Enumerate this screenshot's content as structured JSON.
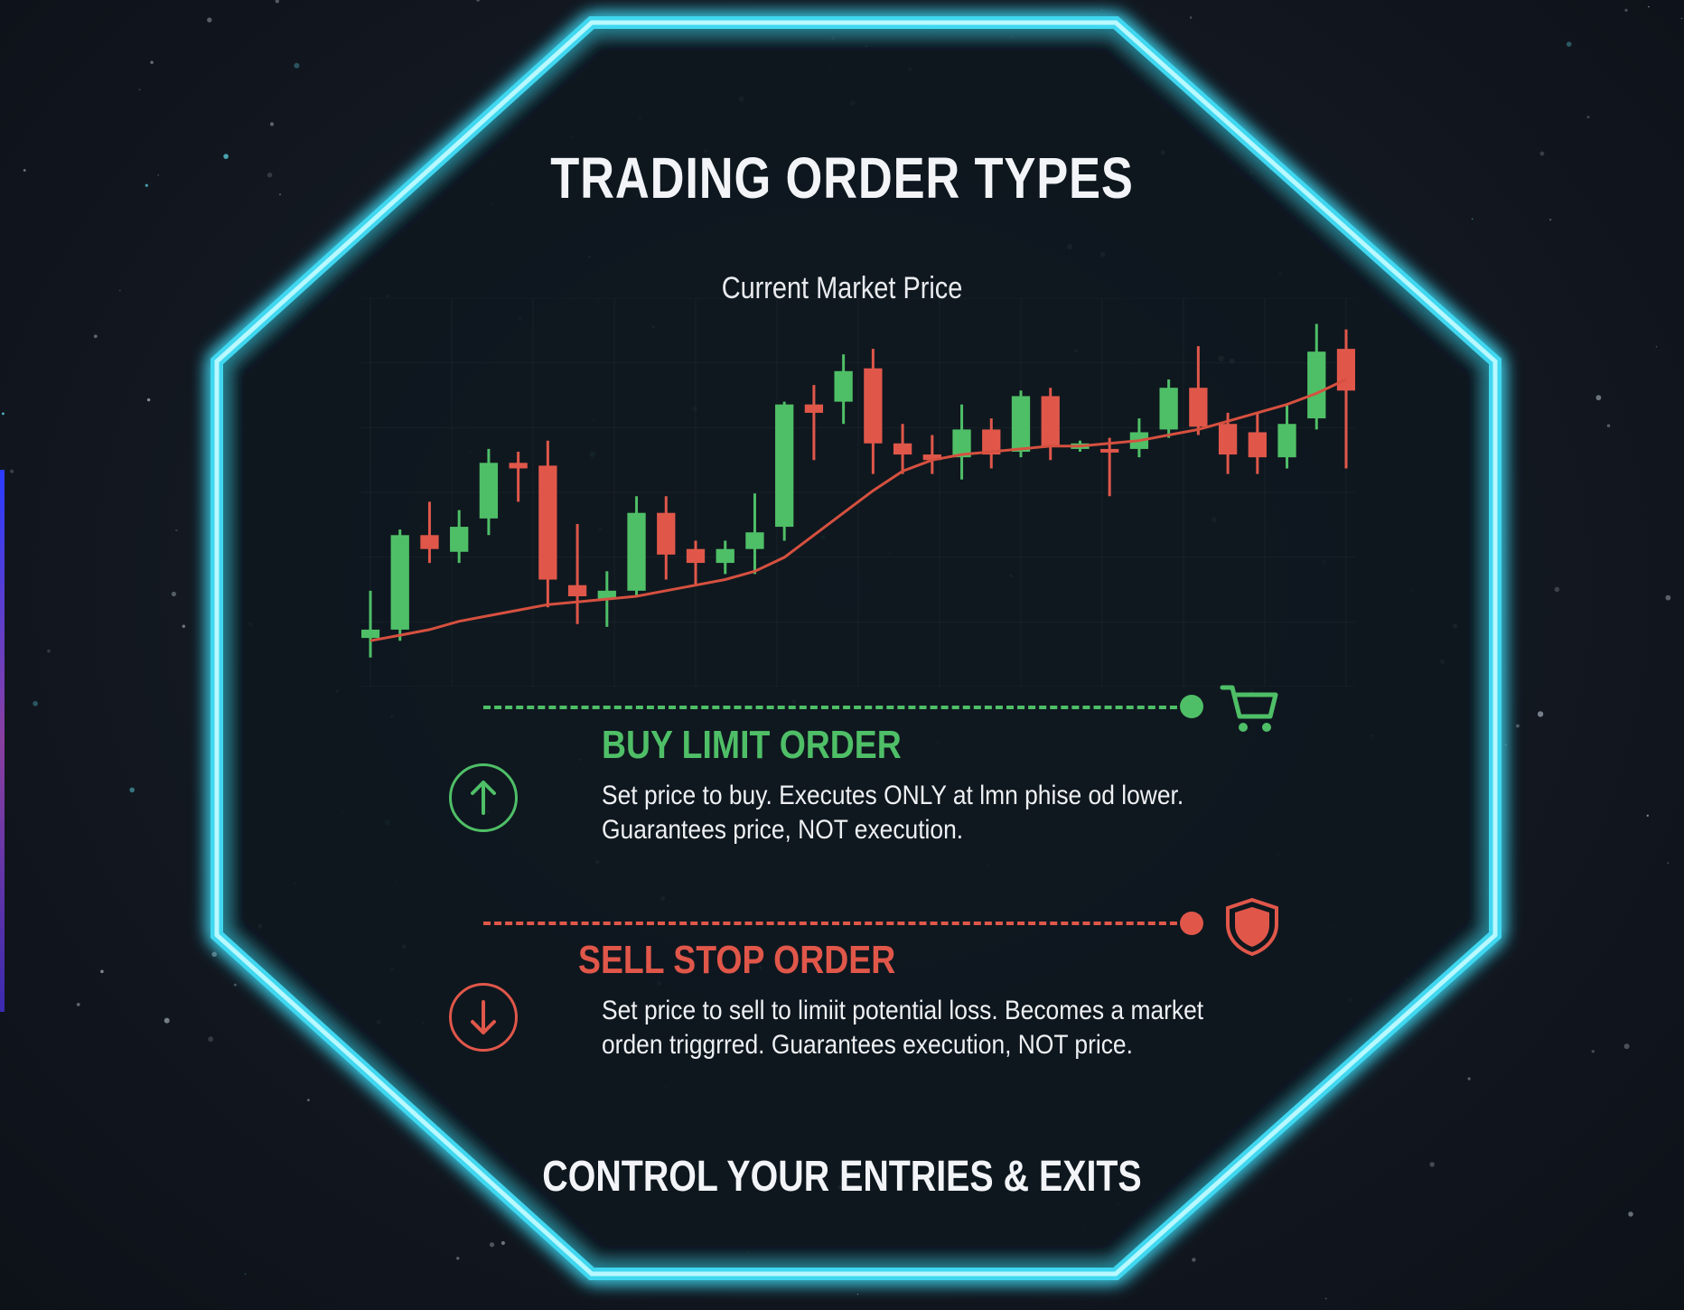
{
  "title": "TRADING ORDER TYPES",
  "chart": {
    "label": "Current Market Price"
  },
  "chart_data": {
    "type": "candlestick",
    "candles": [
      {
        "o": 11,
        "c": 14,
        "h": 28,
        "l": 4
      },
      {
        "o": 14,
        "c": 48,
        "h": 50,
        "l": 10
      },
      {
        "o": 48,
        "c": 43,
        "h": 60,
        "l": 38
      },
      {
        "o": 42,
        "c": 51,
        "h": 57,
        "l": 38
      },
      {
        "o": 54,
        "c": 74,
        "h": 79,
        "l": 48
      },
      {
        "o": 74,
        "c": 72,
        "h": 78,
        "l": 60
      },
      {
        "o": 73,
        "c": 32,
        "h": 82,
        "l": 22
      },
      {
        "o": 30,
        "c": 26,
        "h": 52,
        "l": 16
      },
      {
        "o": 25,
        "c": 28,
        "h": 35,
        "l": 15
      },
      {
        "o": 28,
        "c": 56,
        "h": 62,
        "l": 26
      },
      {
        "o": 56,
        "c": 41,
        "h": 62,
        "l": 32
      },
      {
        "o": 43,
        "c": 38,
        "h": 46,
        "l": 30
      },
      {
        "o": 38,
        "c": 43,
        "h": 46,
        "l": 34
      },
      {
        "o": 43,
        "c": 49,
        "h": 63,
        "l": 34
      },
      {
        "o": 51,
        "c": 95,
        "h": 96,
        "l": 46
      },
      {
        "o": 95,
        "c": 92,
        "h": 102,
        "l": 75
      },
      {
        "o": 96,
        "c": 107,
        "h": 113,
        "l": 88
      },
      {
        "o": 108,
        "c": 81,
        "h": 115,
        "l": 70
      },
      {
        "o": 81,
        "c": 77,
        "h": 88,
        "l": 70
      },
      {
        "o": 77,
        "c": 75,
        "h": 84,
        "l": 70
      },
      {
        "o": 76,
        "c": 86,
        "h": 95,
        "l": 68
      },
      {
        "o": 86,
        "c": 77,
        "h": 90,
        "l": 72
      },
      {
        "o": 78,
        "c": 98,
        "h": 100,
        "l": 76
      },
      {
        "o": 98,
        "c": 80,
        "h": 101,
        "l": 75
      },
      {
        "o": 79,
        "c": 81,
        "h": 82,
        "l": 78
      },
      {
        "o": 79,
        "c": 78,
        "h": 83,
        "l": 62
      },
      {
        "o": 79,
        "c": 85,
        "h": 90,
        "l": 76
      },
      {
        "o": 86,
        "c": 101,
        "h": 104,
        "l": 83
      },
      {
        "o": 101,
        "c": 87,
        "h": 116,
        "l": 84
      },
      {
        "o": 88,
        "c": 77,
        "h": 92,
        "l": 70
      },
      {
        "o": 85,
        "c": 76,
        "h": 92,
        "l": 70
      },
      {
        "o": 76,
        "c": 88,
        "h": 95,
        "l": 72
      },
      {
        "o": 90,
        "c": 114,
        "h": 124,
        "l": 86
      },
      {
        "o": 115,
        "c": 100,
        "h": 122,
        "l": 72
      }
    ],
    "moving_average": [
      10,
      12,
      14,
      17,
      19,
      21,
      23,
      24,
      25,
      26,
      28,
      30,
      32,
      35,
      40,
      48,
      56,
      64,
      71,
      75,
      77,
      78,
      79,
      80,
      80,
      81,
      82,
      84,
      86,
      89,
      92,
      95,
      99,
      104
    ],
    "ylim": [
      0,
      130
    ],
    "grid": true
  },
  "orders": {
    "buy": {
      "title": "BUY LIMIT ORDER",
      "desc_line1": "Set price to buy. Executes ONLY at lmn phise od lower.",
      "desc_line2": "Guarantees price, NOT execution.",
      "icon": "cart-icon",
      "badge_icon": "arrow-up-icon",
      "color": "#4fbf67"
    },
    "sell": {
      "title": "SELL STOP ORDER",
      "desc_line1": "Set price to sell to limiit potential loss. Becomes a market",
      "desc_line2": "orden triggrred. Guarantees execution, NOT price.",
      "icon": "shield-icon",
      "badge_icon": "arrow-down-icon",
      "color": "#e0574a"
    }
  },
  "footer": "CONTROL YOUR ENTRIES & EXITS",
  "colors": {
    "background": "#131821",
    "frame": "#8ff2ff",
    "bull": "#4fbf67",
    "bear": "#e0574a"
  }
}
